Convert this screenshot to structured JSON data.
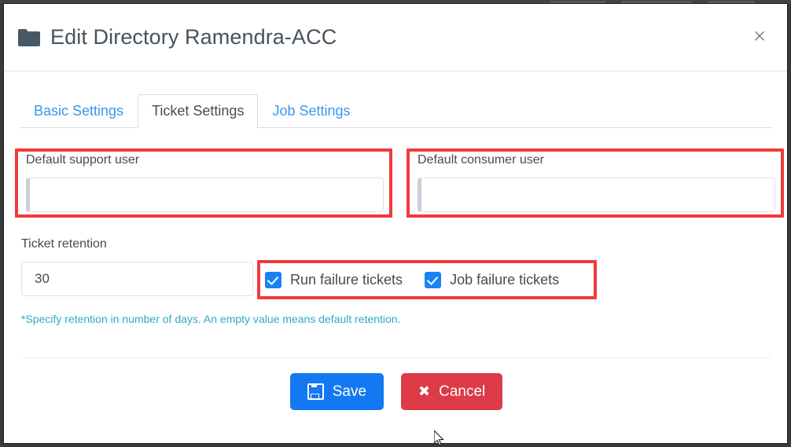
{
  "window": {
    "background_color": "#3a3a3a"
  },
  "dialog": {
    "title": "Edit Directory Ramendra-ACC",
    "title_icon": "folder-icon",
    "close_label": "×"
  },
  "tabs": [
    {
      "label": "Basic Settings",
      "active": false
    },
    {
      "label": "Ticket Settings",
      "active": true
    },
    {
      "label": "Job Settings",
      "active": false
    }
  ],
  "form": {
    "support_user": {
      "label": "Default support user",
      "value": "",
      "placeholder": ""
    },
    "consumer_user": {
      "label": "Default consumer user",
      "value": "",
      "placeholder": ""
    },
    "retention": {
      "label": "Ticket retention",
      "value": "30",
      "placeholder": ""
    },
    "checkboxes": [
      {
        "label": "Run failure tickets",
        "checked": true
      },
      {
        "label": "Job failure tickets",
        "checked": true
      }
    ],
    "hint": "*Specify retention in number of days. An empty value means default retention."
  },
  "footer": {
    "save_label": "Save",
    "save_icon": "floppy-disk-icon",
    "cancel_label": "Cancel",
    "cancel_icon": "times-icon"
  },
  "colors": {
    "accent_blue": "#1279f2",
    "tab_link": "#3a96ec",
    "danger_red": "#dc3b47",
    "annotation_red": "#ef3b3b",
    "hint_teal": "#2eaac6",
    "title_slate": "#46525c"
  }
}
